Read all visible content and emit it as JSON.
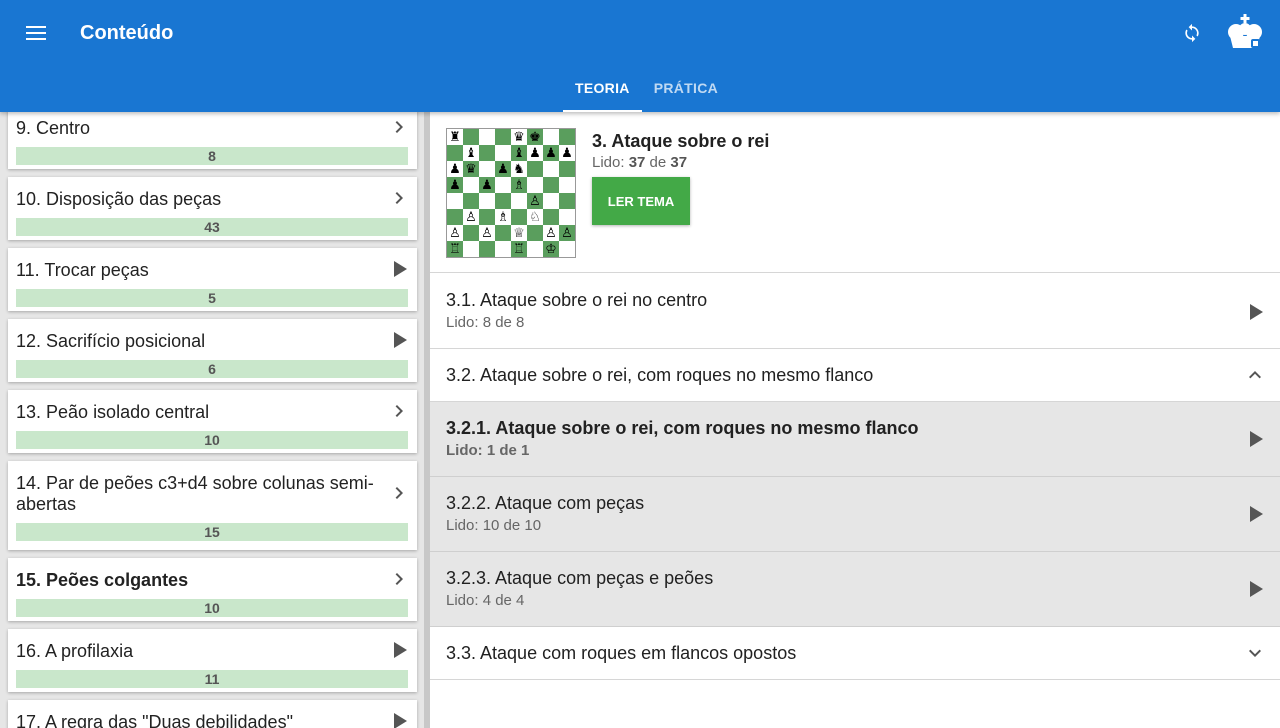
{
  "appbar": {
    "title": "Conteúdo",
    "menu_icon": "hamburger-menu-icon",
    "sync_icon": "sync-icon",
    "logo_icon": "chess-king-logo-icon",
    "color": "#1976d2"
  },
  "tabs": [
    {
      "label": "TEORIA",
      "active": true
    },
    {
      "label": "PRÁTICA",
      "active": false
    }
  ],
  "chapters": [
    {
      "title": "9. Centro",
      "progress": "8",
      "icon": "chevron-right-icon",
      "bold": false
    },
    {
      "title": "10. Disposição das peças",
      "progress": "43",
      "icon": "chevron-right-icon",
      "bold": false
    },
    {
      "title": "11. Trocar peças",
      "progress": "5",
      "icon": "play-arrow-icon",
      "bold": false
    },
    {
      "title": "12. Sacrifício posicional",
      "progress": "6",
      "icon": "play-arrow-icon",
      "bold": false
    },
    {
      "title": "13. Peão isolado central",
      "progress": "10",
      "icon": "chevron-right-icon",
      "bold": false
    },
    {
      "title": "14. Par de peões c3+d4 sobre colunas semi-abertas",
      "progress": "15",
      "icon": "chevron-right-icon",
      "bold": false
    },
    {
      "title": "15. Peões colgantes",
      "progress": "10",
      "icon": "chevron-right-icon",
      "bold": true
    },
    {
      "title": "16. A profilaxia",
      "progress": "11",
      "icon": "play-arrow-icon",
      "bold": false
    },
    {
      "title": "17. A regra das \"Duas debilidades\"",
      "progress": "",
      "icon": "play-arrow-icon",
      "bold": false
    }
  ],
  "topic": {
    "title": "3. Ataque sobre o rei",
    "read_prefix": "Lido: ",
    "read_count": "37",
    "read_sep": " de ",
    "read_total": "37",
    "button_label": "LER TEMA",
    "button_color": "#43a947",
    "board_rows": [
      "♜   ♛♚",
      " ♝  ♝♟♟♟",
      "♟♛ ♟♞  ",
      "♟ ♟ ♗  ",
      "     ♙  ",
      " ♙ ♗ ♘ ",
      "♙ ♙ ♕ ♙♙",
      "♖   ♖ ♔ "
    ]
  },
  "sections": [
    {
      "title": "3.1. Ataque sobre o rei no centro",
      "read": "Lido: 8 de 8",
      "icon": "play-arrow-icon"
    },
    {
      "title": "3.2. Ataque sobre o rei, com roques no mesmo flanco",
      "read": "",
      "icon": "chevron-up-icon"
    },
    {
      "title": "3.2.1. Ataque sobre o rei, com roques no mesmo flanco",
      "read": "Lido: 1 de 1",
      "icon": "play-arrow-icon"
    },
    {
      "title": "3.2.2. Ataque com peças",
      "read": "Lido: 10 de 10",
      "icon": "play-arrow-icon"
    },
    {
      "title": "3.2.3. Ataque com peças e peões",
      "read": "Lido: 4 de 4",
      "icon": "play-arrow-icon"
    },
    {
      "title": "3.3. Ataque com roques em flancos opostos",
      "read": "",
      "icon": "chevron-down-icon"
    }
  ]
}
